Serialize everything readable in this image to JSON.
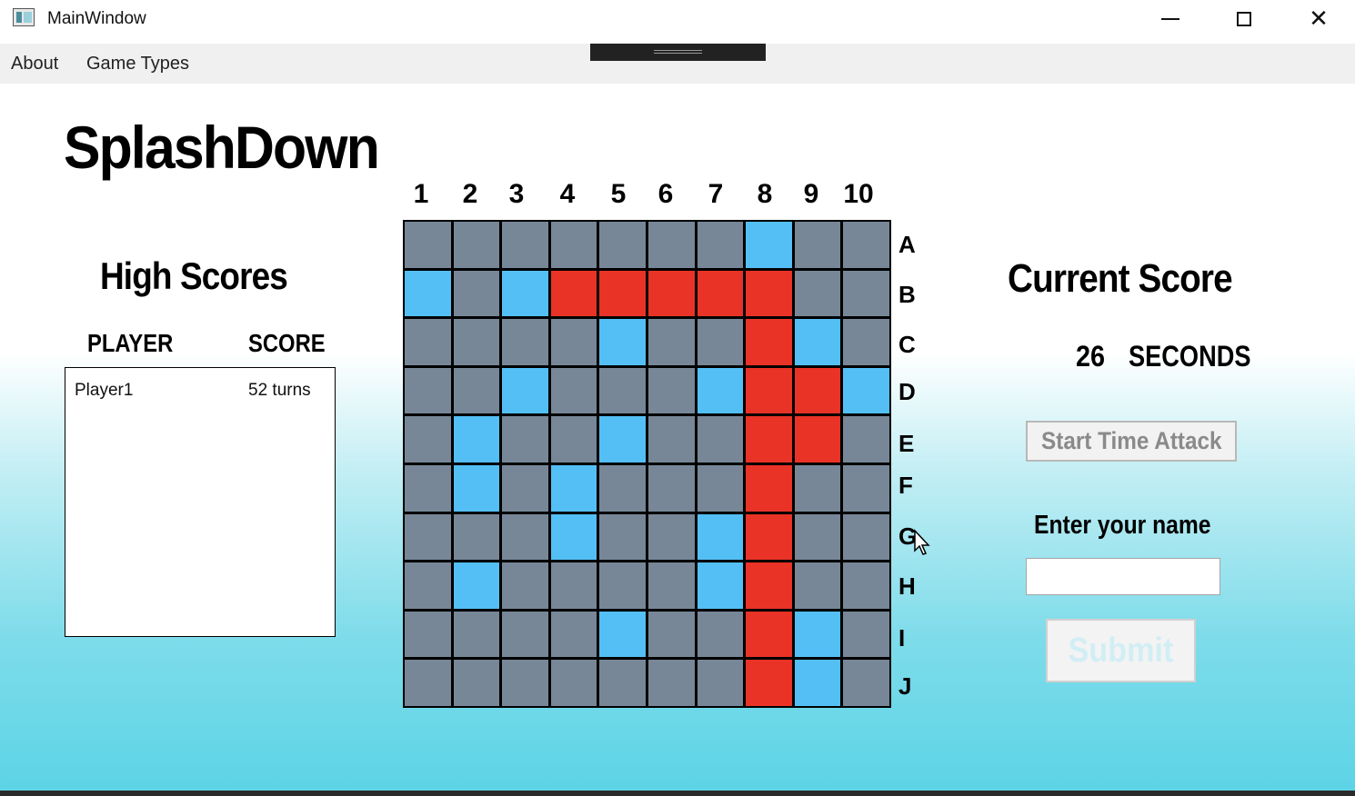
{
  "window": {
    "title": "MainWindow"
  },
  "menu": {
    "items": [
      "About",
      "Game Types"
    ]
  },
  "game": {
    "title": "SplashDown"
  },
  "high_scores": {
    "title": "High Scores",
    "col_player": "PLAYER",
    "col_score": "SCORE",
    "rows": [
      {
        "player": "Player1",
        "score": "52 turns"
      }
    ]
  },
  "board": {
    "columns": [
      "1",
      "2",
      "3",
      "4",
      "5",
      "6",
      "7",
      "8",
      "9",
      "10"
    ],
    "rows": [
      "A",
      "B",
      "C",
      "D",
      "E",
      "F",
      "G",
      "H",
      "I",
      "J"
    ],
    "cells": [
      "-------o--",
      "o-oxxxxx--",
      "----o--xo-",
      "--o---oxxo",
      "-o--o--xx-",
      "-o-o---x--",
      "---o--ox--",
      "-o----ox--",
      "----o--xo-",
      "-------xo-"
    ],
    "legend": {
      "x": "hit",
      "o": "miss",
      "-": "untouched"
    },
    "colors": {
      "hit": "#e93326",
      "miss": "#53bff5",
      "untouched": "#778797",
      "grid_line": "#000000"
    }
  },
  "current_score": {
    "title": "Current Score",
    "value": "26",
    "unit": "SECONDS"
  },
  "controls": {
    "time_attack_label": "Start Time Attack",
    "name_label": "Enter your name",
    "name_value": "",
    "submit_label": "Submit"
  }
}
